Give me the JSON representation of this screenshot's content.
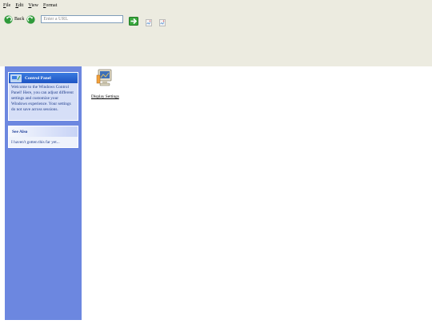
{
  "menu": {
    "items": [
      {
        "accel": "F",
        "rest": "ile"
      },
      {
        "accel": "E",
        "rest": "dit"
      },
      {
        "accel": "V",
        "rest": "iew"
      },
      {
        "accel": "F",
        "rest": "ormat"
      }
    ]
  },
  "nav": {
    "back_label": "Back",
    "url_placeholder": "Enter a URL"
  },
  "sidebar": {
    "control_panel": {
      "title": "Control Panel",
      "body": "Welcome to the Windows Control Panel! Here, you can adjust different settings and customize your Windows experience. Your settings do not save across sessions."
    },
    "see_also": {
      "title": "See Also",
      "body": "I haven't gotten this far yet..."
    }
  },
  "content": {
    "items": [
      {
        "label": "Display Settings",
        "icon": "monitor-icon"
      }
    ]
  },
  "colors": {
    "toolbar_bg": "#ecebe0",
    "sidebar_bg": "#6c87e0",
    "panel_header_blue": "#1f55c4"
  }
}
